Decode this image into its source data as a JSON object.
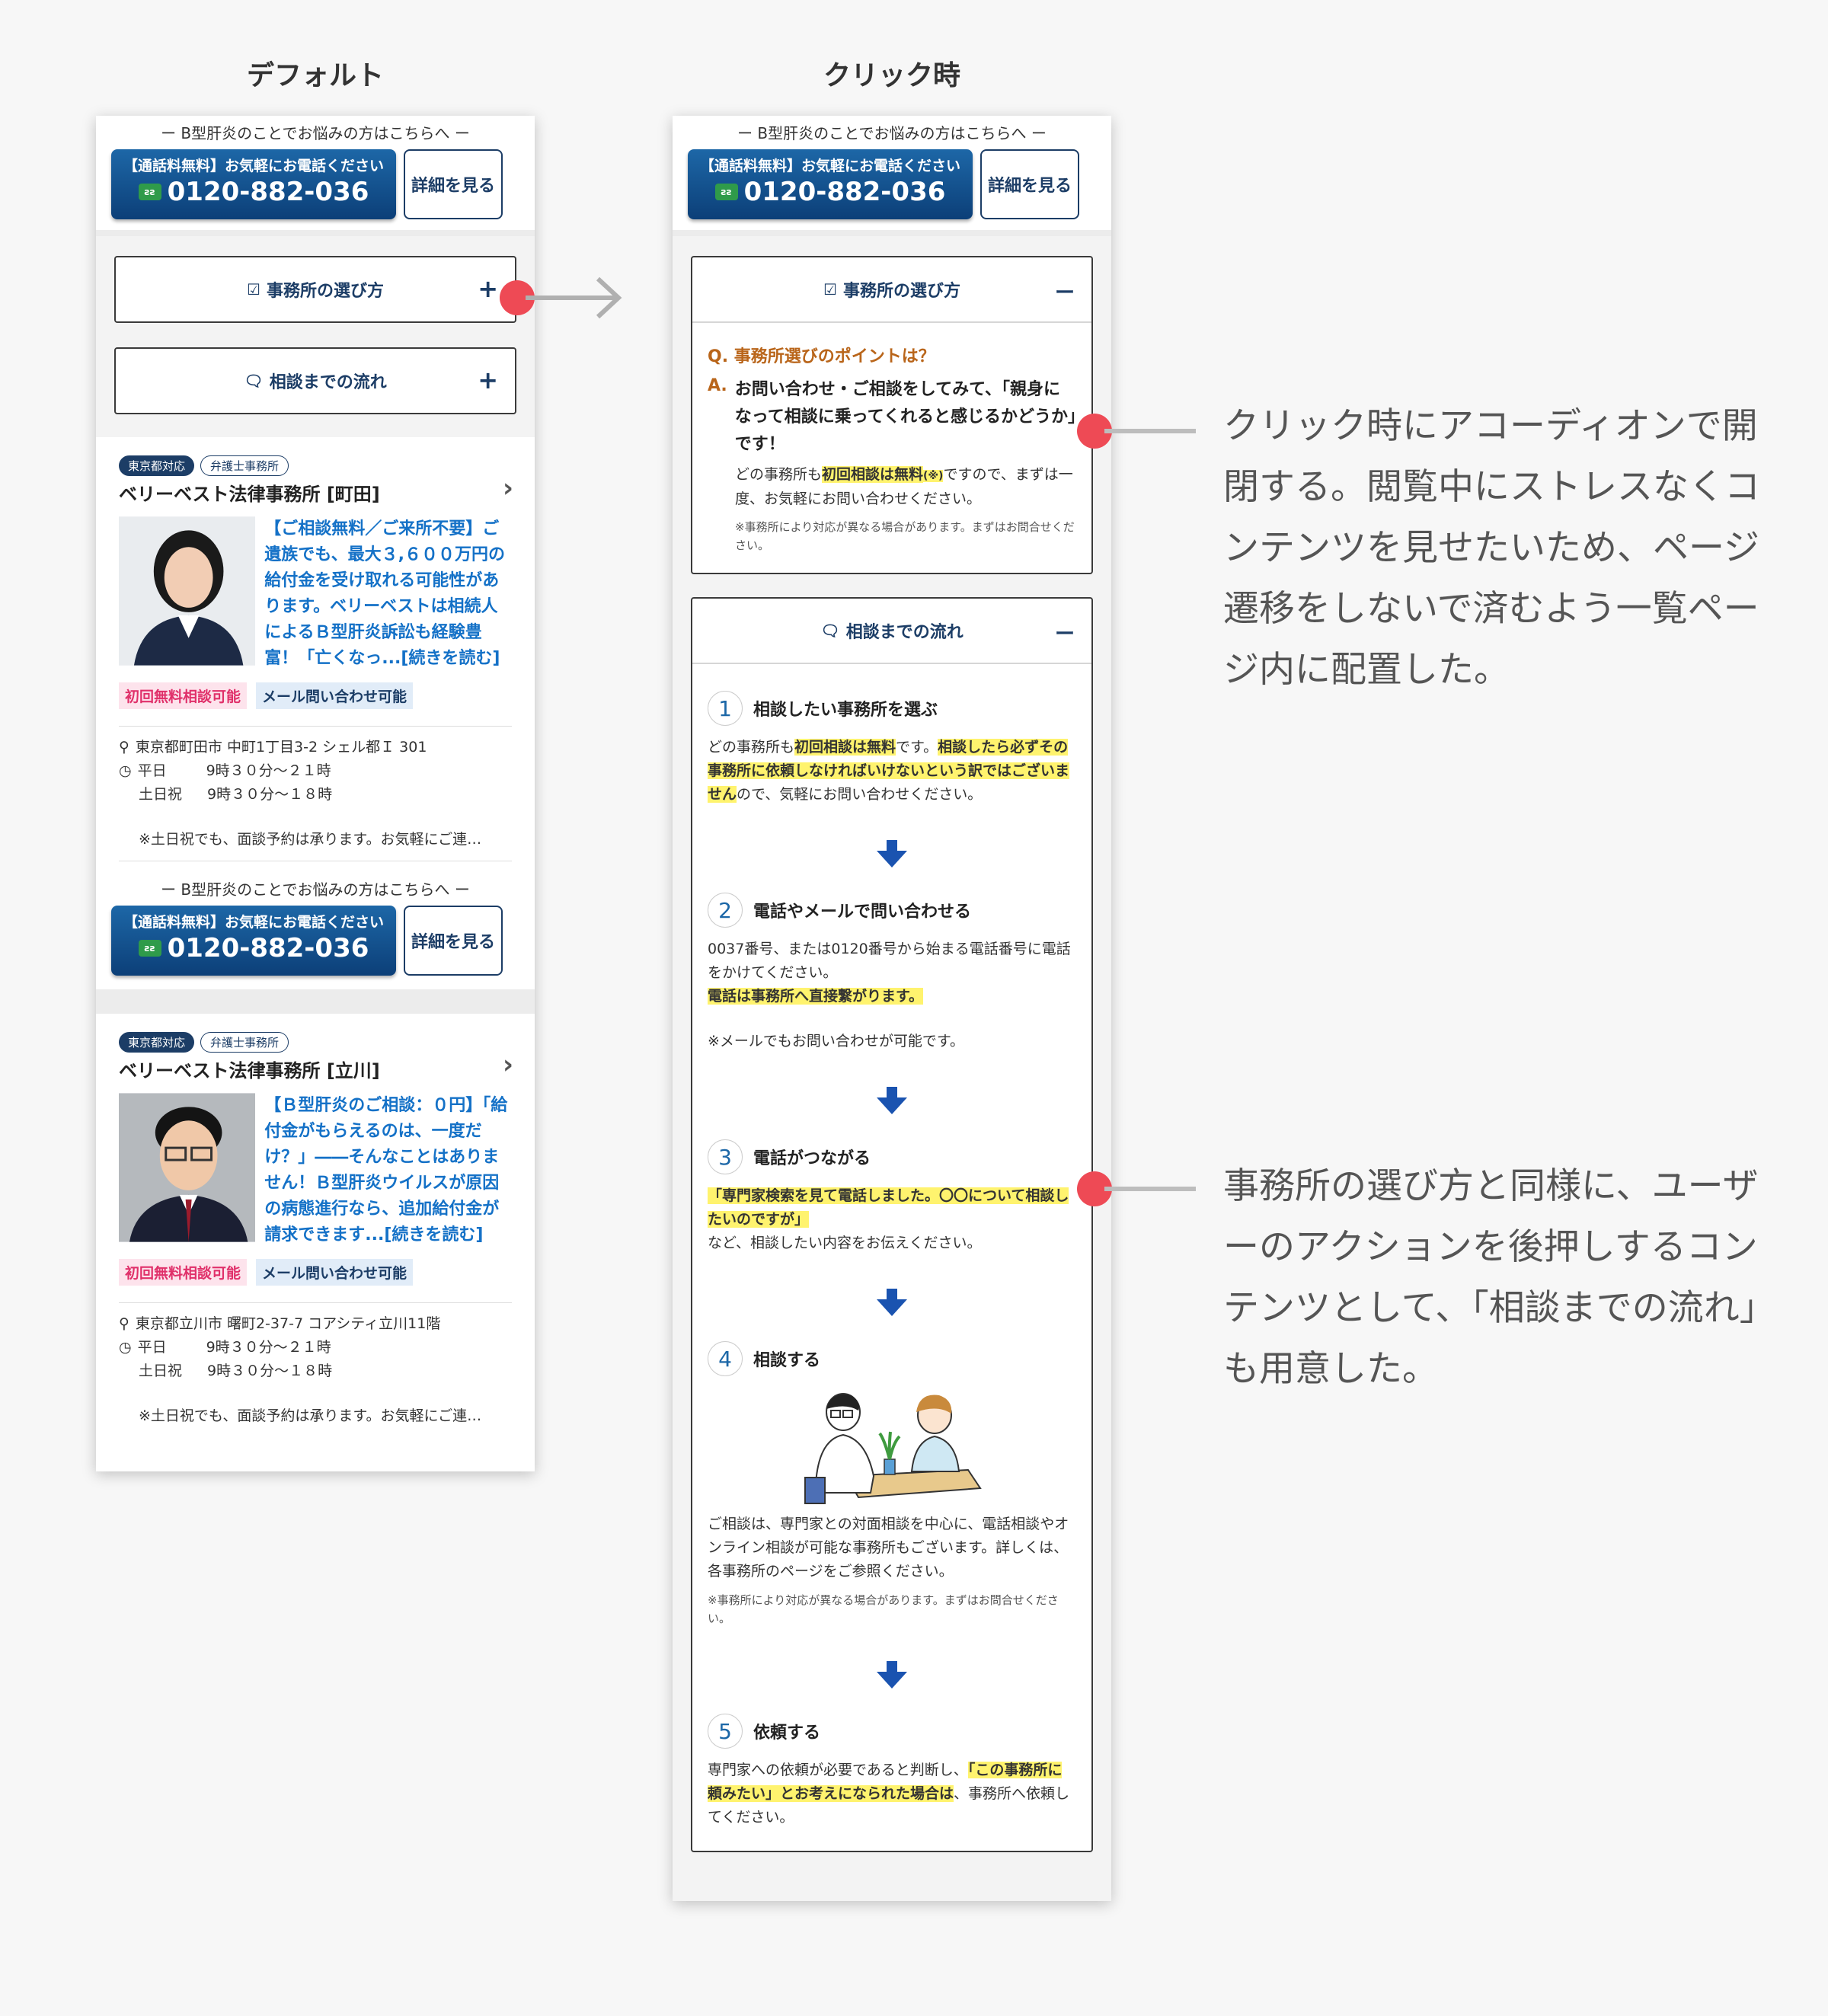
{
  "labels": {
    "default": "デフォルト",
    "clicked": "クリック時"
  },
  "tel": {
    "caption": "ー B型肝炎のことでお悩みの方はこちらへ ー",
    "free_label": "【通話料無料】お気軽にお電話ください",
    "freedial_icon": "freedial-icon",
    "number": "0120-882-036",
    "detail": "詳細を見る"
  },
  "accordions": {
    "choose": {
      "icon": "☑",
      "title": "事務所の選び方",
      "plus": "+",
      "minus": "ー"
    },
    "flow": {
      "icon": "🗨",
      "title": "相談までの流れ",
      "plus": "+",
      "minus": "ー"
    }
  },
  "qa": {
    "q_label": "Q.",
    "question": "事務所選びのポイントは？",
    "a_label": "A.",
    "answer": "お問い合わせ・ご相談をしてみて、「親身になって相談に乗ってくれると感じるかどうか」です！",
    "p_pre": "どの事務所も",
    "p_hl": "初回相談は無料",
    "p_mark": "(※)",
    "p_post": "ですので、まずは一度、お気軽にお問い合わせください。",
    "note": "※事務所により対応が異なる場合があります。まずはお問合せください。"
  },
  "steps": [
    {
      "num": "1",
      "title": "相談したい事務所を選ぶ",
      "pre": "どの事務所も",
      "hl1": "初回相談は無料",
      "mid": "です。",
      "hl2": "相談したら必ずその事務所に依頼しなければいけないという訳ではございません",
      "post": "ので、気軽にお問い合わせください。"
    },
    {
      "num": "2",
      "title": "電話やメールで問い合わせる",
      "p1": "0037番号、または0120番号から始まる電話番号に電話をかけてください。",
      "hl": "電話は事務所へ直接繋がります。",
      "note": "※メールでもお問い合わせが可能です。"
    },
    {
      "num": "3",
      "title": "電話がつながる",
      "hl": "「専門家検索を見て電話しました。〇〇について相談したいのですが」",
      "post": "など、相談したい内容をお伝えください。"
    },
    {
      "num": "4",
      "title": "相談する",
      "p": "ご相談は、専門家との対面相談を中心に、電話相談やオンライン相談が可能な事務所もございます。詳しくは、各事務所のページをご参照ください。",
      "note": "※事務所により対応が異なる場合があります。まずはお問合せください。"
    },
    {
      "num": "5",
      "title": "依頼する",
      "pre": "専門家への依頼が必要であると判断し、",
      "hl": "「この事務所に頼みたい」とお考えになられた場合は",
      "post": "、事務所へ依頼してください。"
    }
  ],
  "offices": [
    {
      "badge1": "東京都対応",
      "badge2": "弁護士事務所",
      "name": "ベリーベスト法律事務所 [町田]",
      "copy": "【ご相談無料／ご来所不要】ご遺族でも、最大３,６００万円の給付金を受け取れる可能性があります。ベリーベストは相続人によるＢ型肝炎訴訟も経験豊富！「亡くなっ...[続きを読む]",
      "tag1": "初回無料相談可能",
      "tag2": "メール問い合わせ可能",
      "address": "東京都町田市 中町1丁目3-2 シェル都Ｉ 301",
      "wd_label": "平日",
      "wd_time": "9時３０分～２１時",
      "we_label": "土日祝",
      "we_time": "9時３０分～１８時",
      "note": "※土日祝でも、面談予約は承ります。お気軽にご連…"
    },
    {
      "badge1": "東京都対応",
      "badge2": "弁護士事務所",
      "name": "ベリーベスト法律事務所 [立川]",
      "copy": "【Ｂ型肝炎のご相談：０円】「給付金がもらえるのは、一度だけ？」――そんなことはありません！Ｂ型肝炎ウイルスが原因の病態進行なら、追加給付金が請求できます...[続きを読む]",
      "tag1": "初回無料相談可能",
      "tag2": "メール問い合わせ可能",
      "address": "東京都立川市 曙町2-37-7 コアシティ立川11階",
      "wd_label": "平日",
      "wd_time": "9時３０分～２１時",
      "we_label": "土日祝",
      "we_time": "9時３０分～１８時",
      "note": "※土日祝でも、面談予約は承ります。お気軽にご連…"
    }
  ],
  "annotations": {
    "a1": "クリック時にアコーディオンで開閉する。閲覧中にストレスなくコンテンツを見せたいため、ページ遷移をしないで済むよう一覧ページ内に配置した。",
    "a2": "事務所の選び方と同様に、ユーザーのアクションを後押しするコンテンツとして、「相談までの流れ」も用意した。"
  },
  "colors": {
    "navy": "#1c3d66",
    "accent_red": "#ee4a55",
    "highlight": "#fff36e",
    "link_blue": "#1471c7"
  }
}
